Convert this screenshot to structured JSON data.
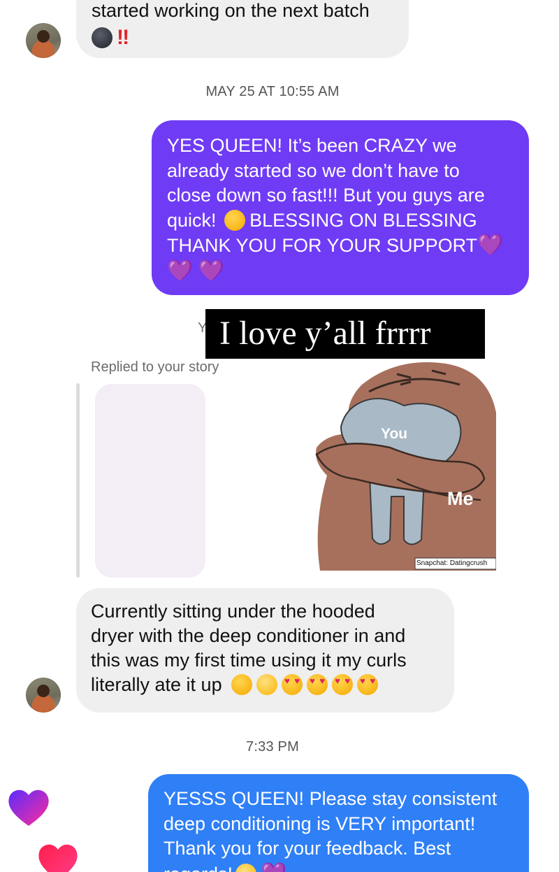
{
  "messages": {
    "first_incoming_tail": "started working on the next batch",
    "first_incoming_emoji": [
      "new-moon-face-emoji",
      "double-exclamation-emoji"
    ],
    "double_bang": "‼",
    "timestamp_1": "MAY 25 AT 10:55 AM",
    "outgoing_1": {
      "lines": [
        "YES QUEEN! It’s been CRAZY we",
        "already started so we don’t have to",
        "close down so fast!!! But you guys are",
        "quick!",
        "BLESSING ON BLESSING",
        "THANK YOU FOR YOUR SUPPORT"
      ],
      "heart": "💜"
    },
    "story_overlay_text": "I love y’all frrrr",
    "story_hidden_letter": "Y",
    "story_reply_label": "Replied to your story",
    "sticker": {
      "label_you": "You",
      "label_me": "Me",
      "watermark": "Snapchat: Datingcrush"
    },
    "incoming_2": {
      "lines": [
        "Currently sitting under the hooded",
        "dryer with the deep conditioner in and",
        "this was my first time using it my curls",
        "literally ate it up"
      ]
    },
    "timestamp_2": "7:33 PM",
    "outgoing_2": {
      "lines": [
        "YESSS QUEEN! Please stay consistent",
        "deep conditioning is VERY important!",
        "Thank you for your feedback. Best",
        "regards!"
      ]
    }
  },
  "colors": {
    "outgoing_1_bg": "#6f3bf5",
    "outgoing_2_bg": "#2f7ff7",
    "incoming_bg": "#efefef"
  }
}
